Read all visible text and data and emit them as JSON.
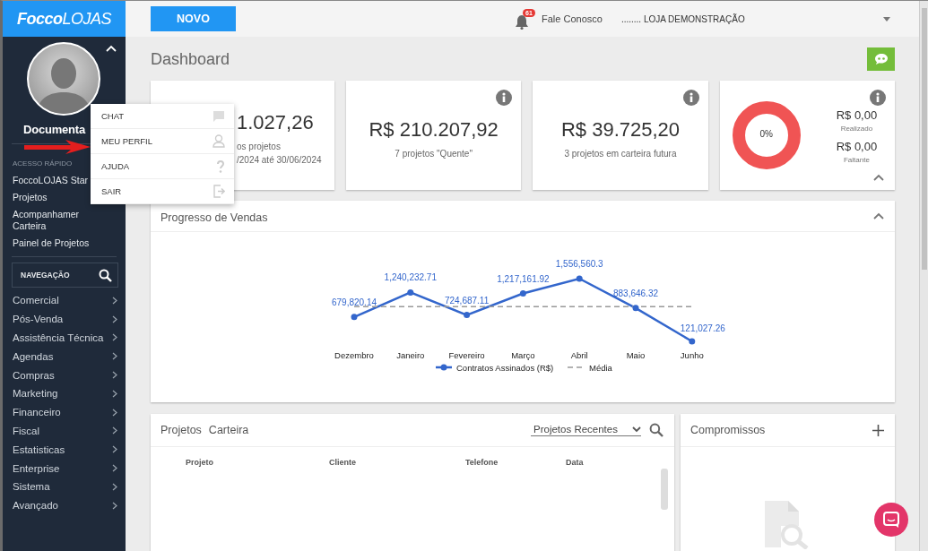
{
  "sidebar": {
    "logo": "**Focco**LOJAS",
    "user_name": "Documenta",
    "section_label": "ACESSO RÁPIDO",
    "quick_links": [
      "FoccoLOJAS Star",
      "Projetos",
      "Acompanhamer Carteira",
      "Painel de Projetos"
    ],
    "nav_search": {
      "placeholder": "NAVEGAÇÃO"
    },
    "nav_items": [
      "Comercial",
      "Pós-Venda",
      "Assistência Técnica",
      "Agendas",
      "Compras",
      "Marketing",
      "Financeiro",
      "Fiscal",
      "Estatisticas",
      "Enterprise",
      "Sistema",
      "Avançado"
    ]
  },
  "topbar": {
    "new_button": "NOVO",
    "notification_count": "61",
    "contact_link": "Fale Conosco",
    "store_selector": "........ LOJA DEMONSTRAÇÃO"
  },
  "page_title": "Dashboard",
  "summary_cards": [
    {
      "kind": "value",
      "info": false,
      "value": "1.027,26",
      "lines": [
        "os projetos",
        "/2024 até 30/06/2024"
      ]
    },
    {
      "kind": "value",
      "info": true,
      "value": "R$ 210.207,92",
      "lines": [
        "7 projetos \"Quente\""
      ]
    },
    {
      "kind": "value",
      "info": true,
      "value": "R$ 39.725,20",
      "lines": [
        "3 projetos em carteira futura"
      ]
    },
    {
      "kind": "goal",
      "info": true,
      "percent": "0%",
      "realized": "R$ 0,00",
      "realized_label": "Realizado",
      "missing": "R$ 0,00",
      "missing_label": "Faltante"
    }
  ],
  "sales_chart": {
    "title": "Progresso de Vendas",
    "chart_data": {
      "type": "line",
      "legend": "bottom",
      "categories": [
        "Dezembro",
        "Janeiro",
        "Fevereiro",
        "Março",
        "Abril",
        "Maio",
        "Junho"
      ],
      "series": [
        {
          "name": "Contratos Assinados (R$)",
          "color": "#3366cc",
          "marker": "circle",
          "line_style": "solid",
          "value_labels": [
            "679,820.14",
            "1,240,232.71",
            "724,687.11",
            "1,217,161.92",
            "1,556,560.3",
            "883,646.32",
            "121,027.26"
          ],
          "values": [
            679820.14,
            1240232.71,
            724687.11,
            1217161.92,
            1556560.3,
            883646.32,
            121027.26
          ]
        },
        {
          "name": "Média",
          "color": "#999999",
          "line_style": "dashed",
          "values": [
            916723,
            916723,
            916723,
            916723,
            916723,
            916723,
            916723
          ]
        }
      ]
    }
  },
  "projects_panel": {
    "tabs": [
      "Projetos",
      "Carteira"
    ],
    "filter": "Projetos Recentes",
    "columns": [
      "Projeto",
      "Cliente",
      "Telefone",
      "Data"
    ]
  },
  "appointments_panel": {
    "title": "Compromissos"
  },
  "user_menu": [
    {
      "kind": "chat",
      "label": "CHAT"
    },
    {
      "kind": "profile",
      "label": "MEU PERFIL"
    },
    {
      "kind": "help",
      "label": "AJUDA"
    },
    {
      "kind": "exit",
      "label": "SAIR"
    }
  ]
}
